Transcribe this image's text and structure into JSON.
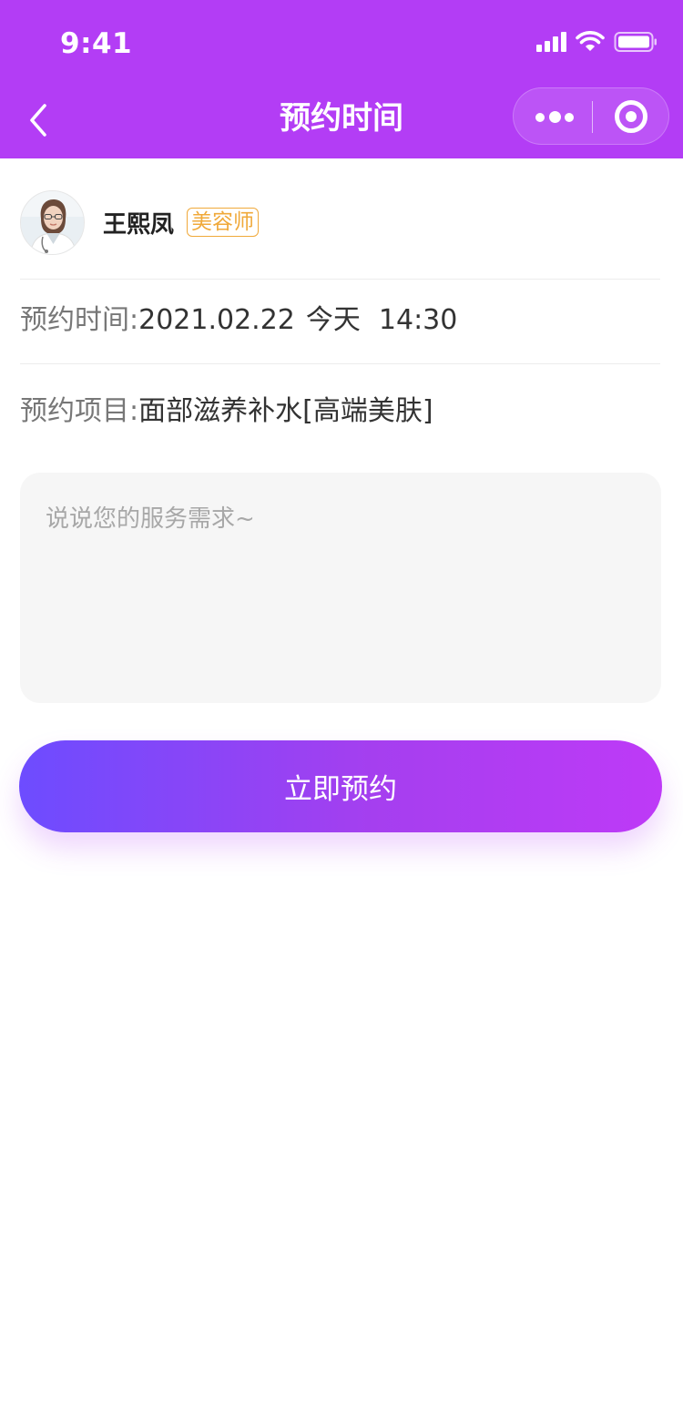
{
  "status_bar": {
    "time": "9:41"
  },
  "nav": {
    "title": "预约时间"
  },
  "beautician": {
    "name": "王熙凤",
    "role": "美容师"
  },
  "appointment": {
    "time_label": "预约时间:",
    "date": "2021.02.22",
    "day": "今天",
    "time": "14:30",
    "item_label": "预约项目:",
    "item": "面部滋养补水[高端美肤]"
  },
  "remark": {
    "placeholder": "说说您的服务需求~",
    "value": ""
  },
  "submit": {
    "label": "立即预约"
  },
  "colors": {
    "header": "#b33df5",
    "badge": "#f0a93a",
    "button_start": "#6d4cff",
    "button_end": "#be3af7"
  }
}
